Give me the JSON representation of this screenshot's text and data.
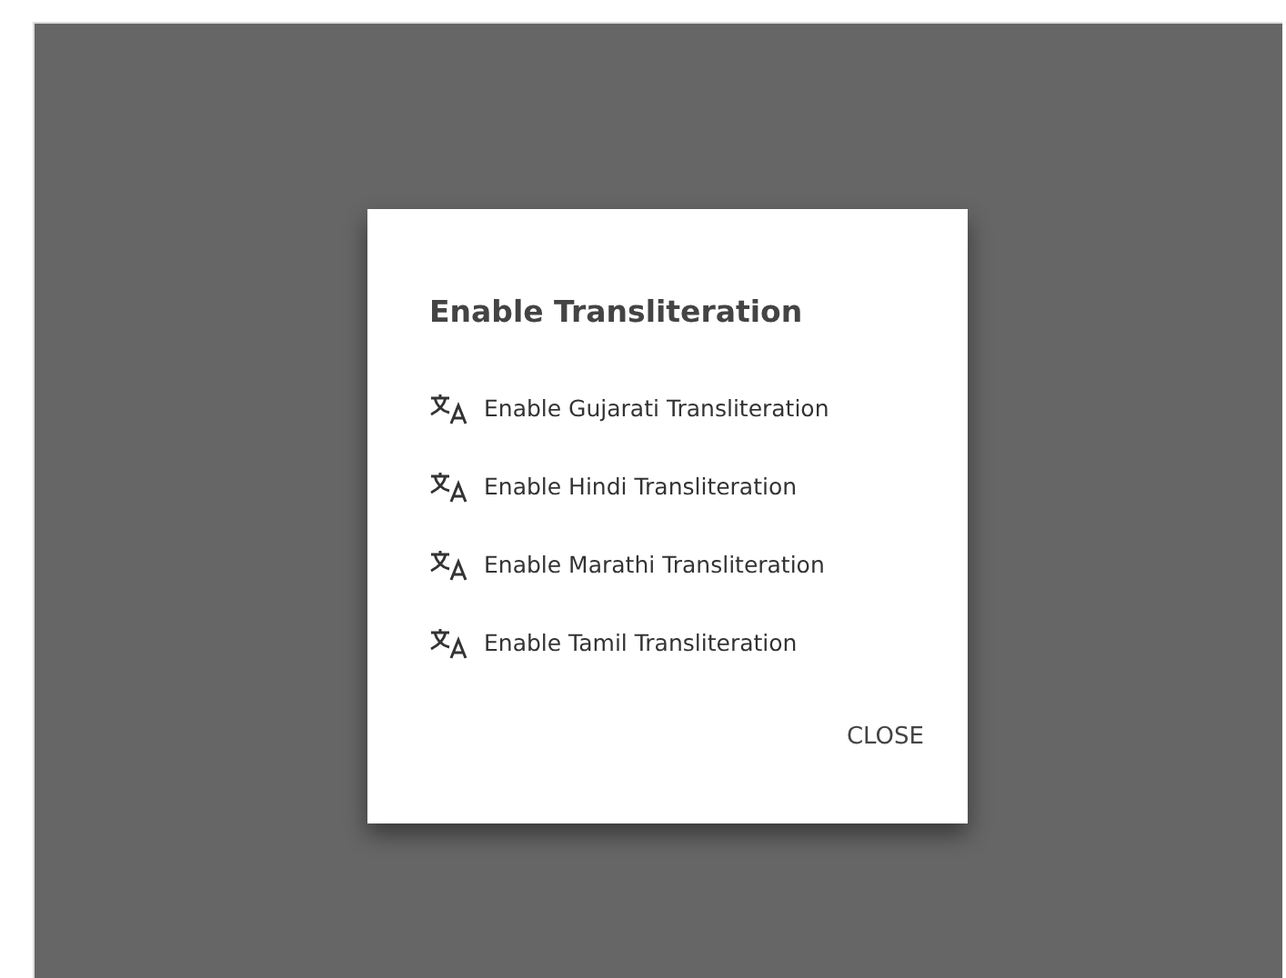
{
  "dialog": {
    "title": "Enable Transliteration",
    "items": [
      {
        "label": "Enable Gujarati Transliteration"
      },
      {
        "label": "Enable Hindi Transliteration"
      },
      {
        "label": "Enable Marathi Transliteration"
      },
      {
        "label": "Enable Tamil Transliteration"
      }
    ],
    "close_button": "CLOSE"
  }
}
